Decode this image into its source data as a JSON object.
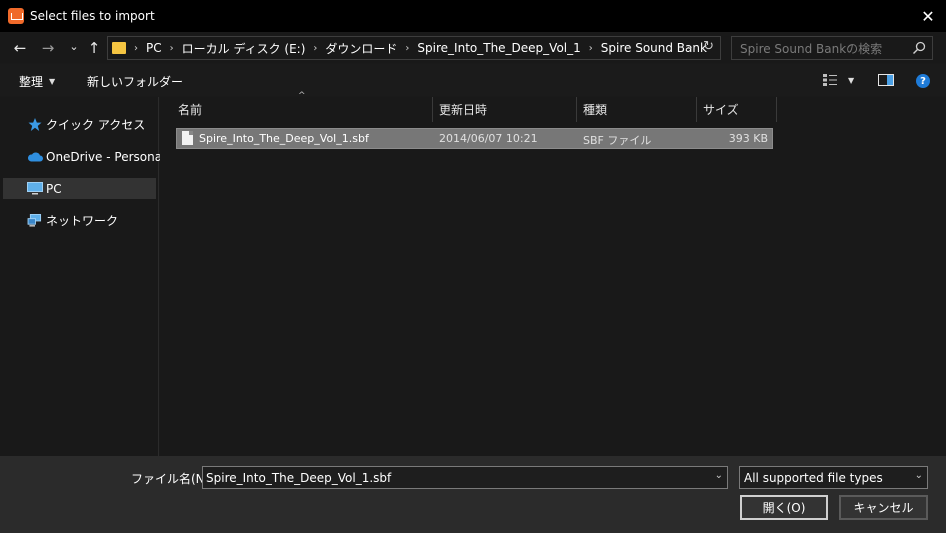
{
  "window": {
    "title": "Select files to import",
    "close_glyph": "✕"
  },
  "nav": {
    "back_glyph": "←",
    "forward_glyph": "→",
    "recent_glyph": "⌄",
    "up_glyph": "↑",
    "breadcrumb": [
      "PC",
      "ローカル ディスク (E:)",
      "ダウンロード",
      "Spire_Into_The_Deep_Vol_1",
      "Spire Sound Bank"
    ],
    "crumb_sep": "›",
    "dropdown_glyph": "⌄",
    "refresh_glyph": "↻",
    "search_placeholder": "Spire Sound Bankの検索"
  },
  "toolbar": {
    "organize_label": "整理",
    "organize_arrow": "▼",
    "new_folder_label": "新しいフォルダー",
    "view_arrow": "▼",
    "help_glyph": "?"
  },
  "sidebar": {
    "items": [
      {
        "label": "クイック アクセス",
        "icon": "star-icon"
      },
      {
        "label": "OneDrive - Personal",
        "icon": "cloud-icon"
      },
      {
        "label": "PC",
        "icon": "monitor-icon"
      },
      {
        "label": "ネットワーク",
        "icon": "network-icon"
      }
    ]
  },
  "columns": {
    "name": "名前",
    "date": "更新日時",
    "type": "種類",
    "size": "サイズ",
    "sort_glyph": "^"
  },
  "files": [
    {
      "name": "Spire_Into_The_Deep_Vol_1.sbf",
      "date": "2014/06/07 10:21",
      "type": "SBF ファイル",
      "size": "393 KB"
    }
  ],
  "footer": {
    "filename_label": "ファイル名(N):",
    "filename_value": "Spire_Into_The_Deep_Vol_1.sbf",
    "dropdown_glyph": "⌄",
    "filetype_value": "All supported file types",
    "open_label": "開く(O)",
    "cancel_label": "キャンセル"
  },
  "colors": {
    "accent_icon": "#f06a2a",
    "folder": "#f5c542",
    "help": "#1e7bd8",
    "selection": "#777777"
  }
}
